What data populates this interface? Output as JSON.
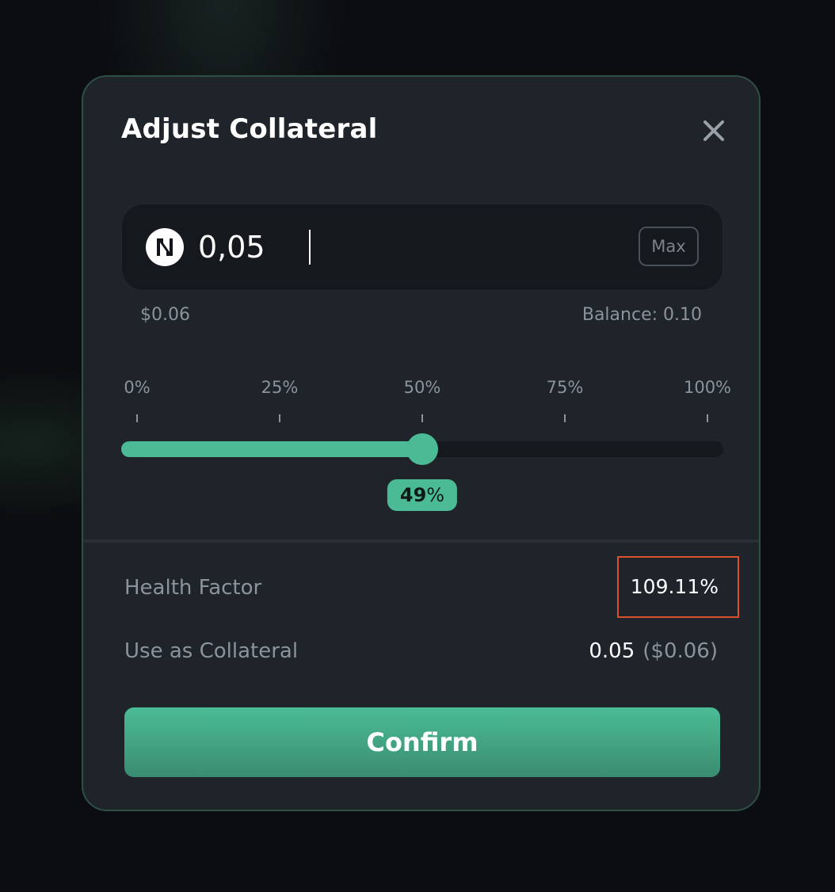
{
  "modal": {
    "title": "Adjust Collateral"
  },
  "amount": {
    "value": "0,05",
    "token_icon": "near-logo-icon",
    "max_label": "Max",
    "usd_value": "$0.06",
    "balance_text": "Balance: 0.10"
  },
  "slider": {
    "ticks": [
      "0%",
      "25%",
      "50%",
      "75%",
      "100%"
    ],
    "value_percent": 49,
    "badge_number": "49",
    "badge_suffix": "%"
  },
  "details": {
    "health_factor_label": "Health Factor",
    "health_factor_value": "109.11%",
    "collateral_label": "Use as Collateral",
    "collateral_amount": "0.05",
    "collateral_usd": "($0.06)"
  },
  "confirm_label": "Confirm",
  "colors": {
    "accent": "#4abb94",
    "modal_bg": "#1f232a",
    "input_bg": "#15181d",
    "highlight_border": "#d9512c"
  }
}
